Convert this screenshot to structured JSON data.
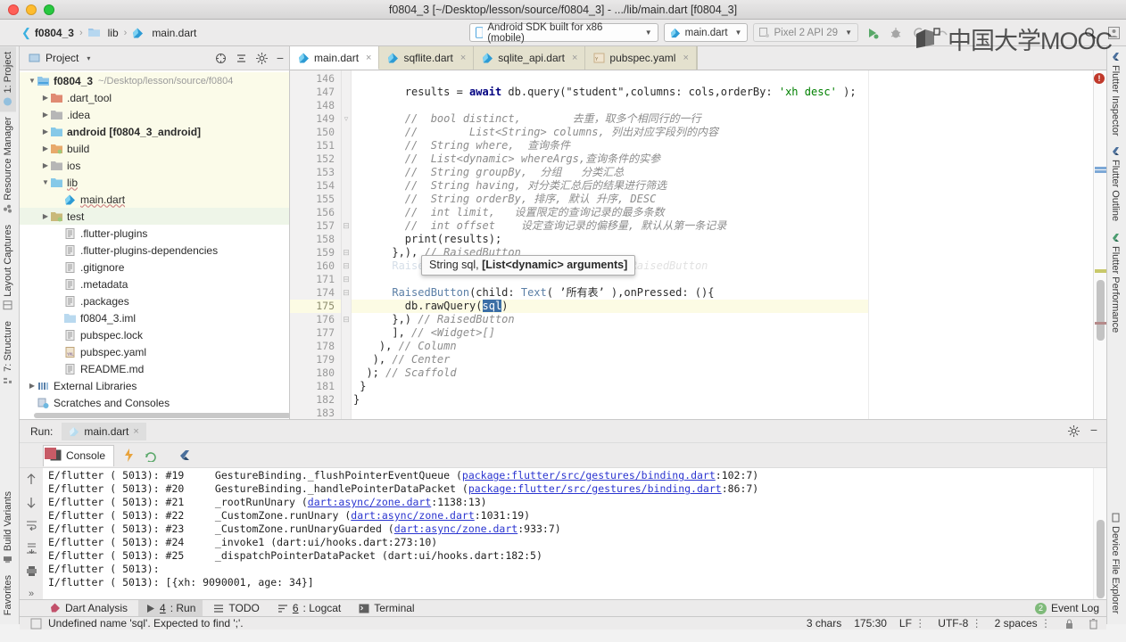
{
  "window": {
    "title": "f0804_3 [~/Desktop/lesson/source/f0804_3] - .../lib/main.dart [f0804_3]"
  },
  "watermark": {
    "text": "中国大学MOOC"
  },
  "breadcrumb": {
    "project": "f0804_3",
    "folder": "lib",
    "file": "main.dart",
    "sep": "›"
  },
  "toolbar": {
    "device_selector": "Android SDK built for x86 (mobile)",
    "run_config": "main.dart",
    "avd": "Pixel 2 API 29",
    "run_icon": "run-icon",
    "debug_icon": "debug-icon",
    "profile_icon": "profile-icon",
    "stop_icon": "stop-icon",
    "search_icon": "search-icon",
    "avatar_icon": "avatar-icon"
  },
  "left_strip": {
    "top": [
      {
        "label": "1: Project",
        "icon": "project-icon",
        "selected": true
      },
      {
        "label": "Resource Manager",
        "icon": "resource-icon",
        "selected": false
      },
      {
        "label": "Layout Captures",
        "icon": "layout-captures-icon",
        "selected": false
      },
      {
        "label": "7: Structure",
        "icon": "structure-icon",
        "selected": false
      }
    ],
    "bottom": [
      {
        "label": "Build Variants",
        "icon": "build-variants-icon"
      },
      {
        "label": "Favorites",
        "icon": "favorites-icon"
      }
    ]
  },
  "right_strip": {
    "top": [
      {
        "label": "Flutter Inspector",
        "icon": "flutter-icon"
      },
      {
        "label": "Flutter Outline",
        "icon": "flutter-icon"
      },
      {
        "label": "Flutter Performance",
        "icon": "flutter-icon"
      }
    ],
    "bottom": [
      {
        "label": "Device File Explorer",
        "icon": "device-file-icon"
      }
    ]
  },
  "project_panel": {
    "title": "Project",
    "dropdown_caret": "▾",
    "header_icons": [
      "target-icon",
      "collapse-all-icon",
      "settings-gear-icon",
      "hide-icon"
    ],
    "tree": [
      {
        "indent": 0,
        "arrow": "▼",
        "icon": "folder-project",
        "label": "f0804_3",
        "bold": true,
        "path": "~/Desktop/lesson/source/f0804",
        "hl": true
      },
      {
        "indent": 1,
        "arrow": "▶",
        "icon": "folder-red",
        "label": ".dart_tool",
        "bold": false,
        "path": "",
        "hl": true
      },
      {
        "indent": 1,
        "arrow": "▶",
        "icon": "folder-grey",
        "label": ".idea",
        "bold": false,
        "path": "",
        "hl": true
      },
      {
        "indent": 1,
        "arrow": "▶",
        "icon": "folder-blue",
        "label": "android [f0804_3_android]",
        "bold": true,
        "path": "",
        "hl": true
      },
      {
        "indent": 1,
        "arrow": "▶",
        "icon": "folder-orange",
        "label": "build",
        "bold": false,
        "path": "",
        "hl": true
      },
      {
        "indent": 1,
        "arrow": "▶",
        "icon": "folder-grey",
        "label": "ios",
        "bold": false,
        "path": "",
        "hl": true
      },
      {
        "indent": 1,
        "arrow": "▼",
        "icon": "folder-blue",
        "label": "lib",
        "bold": false,
        "path": "",
        "hl": true
      },
      {
        "indent": 2,
        "arrow": "",
        "icon": "dart-file",
        "label": "main.dart",
        "bold": false,
        "path": "",
        "hl": true
      },
      {
        "indent": 1,
        "arrow": "▶",
        "icon": "folder-test",
        "label": "test",
        "bold": false,
        "path": "",
        "hl": false,
        "selected": true
      },
      {
        "indent": 2,
        "arrow": "",
        "icon": "text-file",
        "label": ".flutter-plugins",
        "bold": false,
        "path": "",
        "hl": false
      },
      {
        "indent": 2,
        "arrow": "",
        "icon": "text-file",
        "label": ".flutter-plugins-dependencies",
        "bold": false,
        "path": "",
        "hl": false
      },
      {
        "indent": 2,
        "arrow": "",
        "icon": "text-file",
        "label": ".gitignore",
        "bold": false,
        "path": "",
        "hl": false
      },
      {
        "indent": 2,
        "arrow": "",
        "icon": "text-file",
        "label": ".metadata",
        "bold": false,
        "path": "",
        "hl": false
      },
      {
        "indent": 2,
        "arrow": "",
        "icon": "text-file",
        "label": ".packages",
        "bold": false,
        "path": "",
        "hl": false
      },
      {
        "indent": 2,
        "arrow": "",
        "icon": "iml-file",
        "label": "f0804_3.iml",
        "bold": false,
        "path": "",
        "hl": false
      },
      {
        "indent": 2,
        "arrow": "",
        "icon": "text-file",
        "label": "pubspec.lock",
        "bold": false,
        "path": "",
        "hl": false
      },
      {
        "indent": 2,
        "arrow": "",
        "icon": "yaml-file",
        "label": "pubspec.yaml",
        "bold": false,
        "path": "",
        "hl": false
      },
      {
        "indent": 2,
        "arrow": "",
        "icon": "text-file",
        "label": "README.md",
        "bold": false,
        "path": "",
        "hl": false
      },
      {
        "indent": 0,
        "arrow": "▶",
        "icon": "libraries-icon",
        "label": "External Libraries",
        "bold": false,
        "path": "",
        "hl": false
      },
      {
        "indent": 0,
        "arrow": "",
        "icon": "scratches-icon",
        "label": "Scratches and Consoles",
        "bold": false,
        "path": "",
        "hl": false
      }
    ]
  },
  "editor_tabs": [
    {
      "label": "main.dart",
      "icon": "dart-file",
      "active": true
    },
    {
      "label": "sqflite.dart",
      "icon": "dart-file",
      "active": false
    },
    {
      "label": "sqlite_api.dart",
      "icon": "dart-file",
      "active": false
    },
    {
      "label": "pubspec.yaml",
      "icon": "yaml-file",
      "active": false
    }
  ],
  "editor": {
    "line_numbers": [
      "146",
      "147",
      "148",
      "149",
      "150",
      "151",
      "152",
      "153",
      "154",
      "155",
      "156",
      "157",
      "158",
      "159",
      "160",
      "171",
      "174",
      "175",
      "176",
      "177",
      "178",
      "179",
      "180",
      "181",
      "182",
      "183"
    ],
    "current_line": "175",
    "lines": [
      "",
      "        results = await db.query(\"student\",columns: cols,orderBy: 'xh desc' );",
      "",
      "        //  bool distinct,        去重，取多个相同行的一行",
      "        //        List<String> columns, 列出对应字段列的内容",
      "        //  String where,  查询条件",
      "        //  List<dynamic> whereArgs,查询条件的实参",
      "        //  String groupBy,  分组   分类汇总",
      "        //  String having, 对分类汇总后的结果进行筛选",
      "        //  String orderBy, 排序, 默认 升序, DESC",
      "        //  int limit,   设置限定的查询记录的最多条数",
      "        //  int offset    设定查询记录的偏移量, 默认从第一条记录",
      "        print(results);",
      "      },), // RaisedButton",
      "      RaisedButton(child: Text('...'),  // RaisedButton",
      "",
      "      RaisedButton(child: Text('所有表'),onPressed: (){",
      "        db.rawQuery(sql)",
      "      },) // RaisedButton",
      "      ], // <Widget>[]",
      "    ), // Column",
      "   ), // Center",
      "  ); // Scaffold",
      " }",
      "}",
      ""
    ],
    "tooltip": {
      "prefix": "String sql, ",
      "bold": "[List<dynamic> arguments]"
    },
    "selected_token": "sql",
    "error_marker_icon": "error-circle-icon"
  },
  "run_panel": {
    "label": "Run:",
    "tab": "main.dart",
    "tab_icon": "dart-file",
    "console_tab": "Console",
    "console_tab_icon": "console-icon",
    "gutter_icons": [
      "scroll-up-icon",
      "scroll-down-icon",
      "soft-wrap-icon",
      "scroll-to-end-icon",
      "print-icon",
      "more-icon"
    ],
    "toolbar_icons": [
      "stop-icon",
      "lightning-icon",
      "restart-icon",
      "flutter-icon"
    ],
    "header_icons": [
      "settings-gear-icon",
      "minimize-icon"
    ],
    "log_lines": [
      {
        "pre": "E/flutter ( 5013): #19     GestureBinding._flushPointerEventQueue (",
        "link": "package:flutter/src/gestures/binding.dart",
        "post": ":102:7)"
      },
      {
        "pre": "E/flutter ( 5013): #20     GestureBinding._handlePointerDataPacket (",
        "link": "package:flutter/src/gestures/binding.dart",
        "post": ":86:7)"
      },
      {
        "pre": "E/flutter ( 5013): #21     _rootRunUnary (",
        "link": "dart:async/zone.dart",
        "post": ":1138:13)"
      },
      {
        "pre": "E/flutter ( 5013): #22     _CustomZone.runUnary (",
        "link": "dart:async/zone.dart",
        "post": ":1031:19)"
      },
      {
        "pre": "E/flutter ( 5013): #23     _CustomZone.runUnaryGuarded (",
        "link": "dart:async/zone.dart",
        "post": ":933:7)"
      },
      {
        "pre": "E/flutter ( 5013): #24     _invoke1 (dart:ui/hooks.dart:273:10)",
        "link": "",
        "post": ""
      },
      {
        "pre": "E/flutter ( 5013): #25     _dispatchPointerDataPacket (dart:ui/hooks.dart:182:5)",
        "link": "",
        "post": ""
      },
      {
        "pre": "E/flutter ( 5013): ",
        "link": "",
        "post": ""
      },
      {
        "pre": "I/flutter ( 5013): [{xh: 9090001, age: 34}]",
        "link": "",
        "post": ""
      }
    ]
  },
  "bottom_tabs": [
    {
      "label": "Dart Analysis",
      "icon": "dart-icon",
      "selected": false,
      "mnemonic": ""
    },
    {
      "label": ": Run",
      "icon": "run-icon",
      "selected": true,
      "mnemonic": "4"
    },
    {
      "label": "TODO",
      "icon": "todo-icon",
      "selected": false,
      "mnemonic": ""
    },
    {
      "label": ": Logcat",
      "icon": "logcat-icon",
      "selected": false,
      "mnemonic": "6"
    },
    {
      "label": "Terminal",
      "icon": "terminal-icon",
      "selected": false,
      "mnemonic": ""
    }
  ],
  "event_log": {
    "label": "Event Log",
    "count": "2"
  },
  "statusbar": {
    "message": "Undefined name 'sql'. Expected to find ';'.",
    "message_icon": "info-icon",
    "chars": "3 chars",
    "caret": "175:30",
    "line_sep": "LF",
    "encoding": "UTF-8",
    "indent": "2 spaces",
    "lock_icon": "lock-icon",
    "trash_icon": "trash-icon",
    "divider": "↕"
  }
}
